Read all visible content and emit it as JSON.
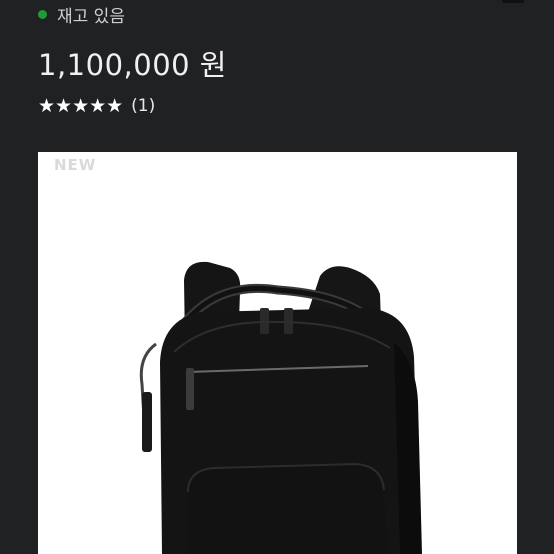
{
  "stock": {
    "label": "재고 있음",
    "status_color": "#1f9a3a"
  },
  "price": {
    "text": "1,100,000 원"
  },
  "rating": {
    "stars": "★★★★★",
    "value": 5,
    "count_text": "(1)"
  },
  "product": {
    "badge": "NEW",
    "icon": "backpack-image"
  }
}
